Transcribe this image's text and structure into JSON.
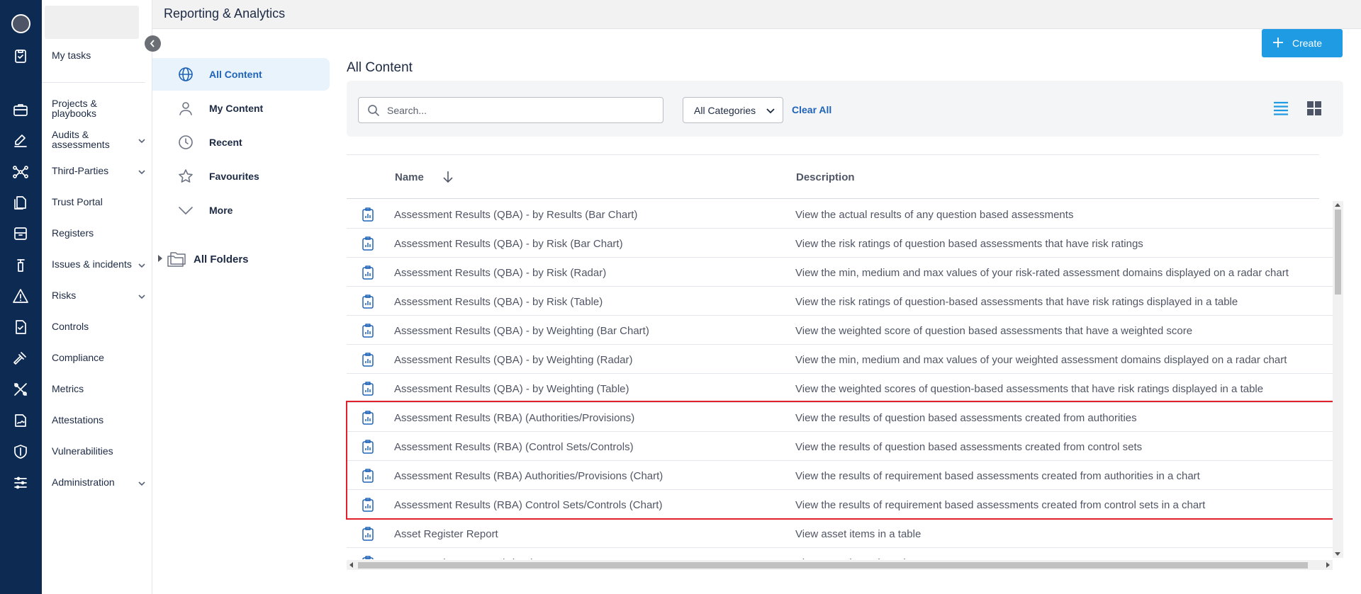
{
  "header": {
    "title": "Reporting & Analytics"
  },
  "nav": {
    "items": [
      {
        "id": "my-tasks",
        "label": "My tasks",
        "has_chevron": false
      },
      {
        "id": "projects",
        "label": "Projects & playbooks",
        "has_chevron": false
      },
      {
        "id": "audits",
        "label": "Audits & assessments",
        "has_chevron": true
      },
      {
        "id": "third-parties",
        "label": "Third-Parties",
        "has_chevron": true
      },
      {
        "id": "trust-portal",
        "label": "Trust Portal",
        "has_chevron": false
      },
      {
        "id": "registers",
        "label": "Registers",
        "has_chevron": false
      },
      {
        "id": "issues",
        "label": "Issues & incidents",
        "has_chevron": true
      },
      {
        "id": "risks",
        "label": "Risks",
        "has_chevron": true
      },
      {
        "id": "controls",
        "label": "Controls",
        "has_chevron": false
      },
      {
        "id": "compliance",
        "label": "Compliance",
        "has_chevron": false
      },
      {
        "id": "metrics",
        "label": "Metrics",
        "has_chevron": false
      },
      {
        "id": "attestations",
        "label": "Attestations",
        "has_chevron": false
      },
      {
        "id": "vulnerabilities",
        "label": "Vulnerabilities",
        "has_chevron": false
      },
      {
        "id": "administration",
        "label": "Administration",
        "has_chevron": true
      }
    ]
  },
  "content_sidebar": {
    "items": [
      {
        "label": "All Content",
        "icon": "globe-icon",
        "active": true
      },
      {
        "label": "My Content",
        "icon": "user-icon",
        "active": false
      },
      {
        "label": "Recent",
        "icon": "clock-icon",
        "active": false
      },
      {
        "label": "Favourites",
        "icon": "star-icon",
        "active": false
      },
      {
        "label": "More",
        "icon": "chevron-down-icon",
        "active": false
      }
    ],
    "folders_label": "All Folders"
  },
  "main": {
    "create_label": "Create",
    "title": "All Content",
    "search": {
      "placeholder": "Search...",
      "value": ""
    },
    "category_select": "All Categories",
    "clear_all": "Clear All"
  },
  "table": {
    "columns": {
      "name": "Name",
      "description": "Description"
    },
    "rows": [
      {
        "name": "Assessment Results (QBA) - by Results (Bar Chart)",
        "description": "View the actual results of any question based assessments"
      },
      {
        "name": "Assessment Results (QBA) - by Risk (Bar Chart)",
        "description": "View the risk ratings of question based assessments that have risk ratings"
      },
      {
        "name": "Assessment Results (QBA) - by Risk (Radar)",
        "description": "View the min, medium and max values of your risk-rated assessment domains displayed on a radar chart"
      },
      {
        "name": "Assessment Results (QBA) - by Risk (Table)",
        "description": "View the risk ratings of question-based assessments that have risk ratings displayed in a table"
      },
      {
        "name": "Assessment Results (QBA) - by Weighting (Bar Chart)",
        "description": "View the weighted score of question based assessments that have a weighted score"
      },
      {
        "name": "Assessment Results (QBA) - by Weighting (Radar)",
        "description": "View the min, medium and max values of your weighted assessment domains displayed on a radar chart"
      },
      {
        "name": "Assessment Results (QBA) - by Weighting (Table)",
        "description": "View the weighted scores of question-based assessments that have risk ratings displayed in a table"
      },
      {
        "name": "Assessment Results (RBA) (Authorities/Provisions)",
        "description": "View the results of question based assessments created from authorities"
      },
      {
        "name": "Assessment Results (RBA) (Control Sets/Controls)",
        "description": "View the results of question based assessments created from control sets"
      },
      {
        "name": "Assessment Results (RBA) Authorities/Provisions (Chart)",
        "description": "View the results of requirement based assessments created from authorities in a chart"
      },
      {
        "name": "Assessment Results (RBA) Control Sets/Controls (Chart)",
        "description": "View the results of requirement based assessments created from control sets in a chart"
      },
      {
        "name": "Asset Register Report",
        "description": "View asset items in a table"
      },
      {
        "name": "Asset Register Report (Chart)",
        "description": "View asset items in a chart"
      }
    ]
  },
  "colors": {
    "rail": "#0c2a52",
    "accent": "#1e9be3",
    "link": "#1f63b7",
    "highlight": "#e0202a"
  }
}
